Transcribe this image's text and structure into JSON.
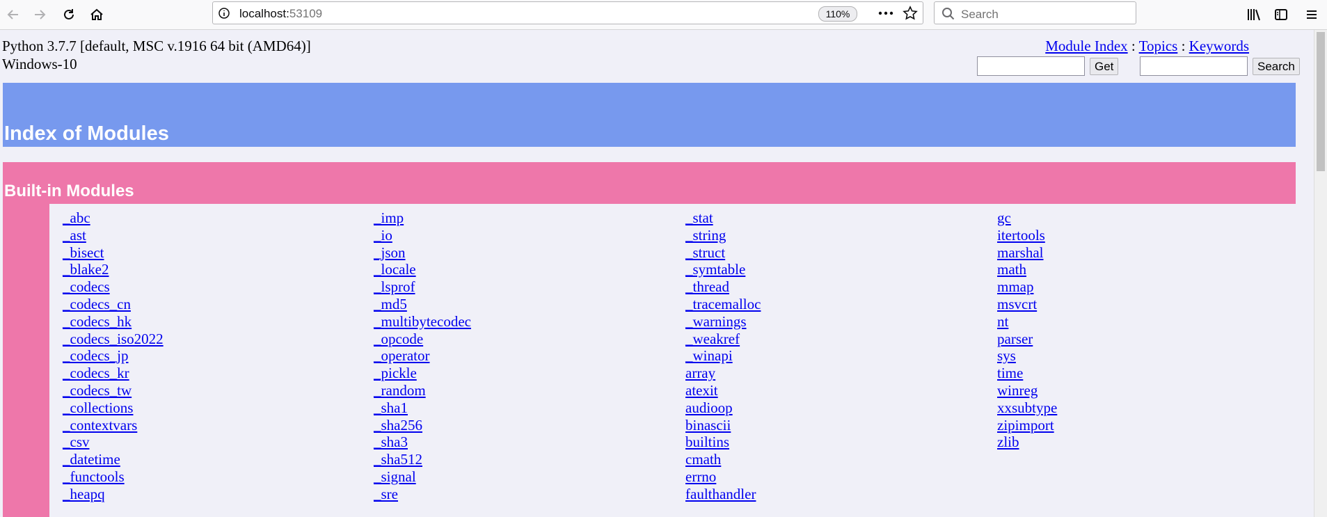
{
  "browser": {
    "url_host": "localhost:",
    "url_port": "53109",
    "zoom": "110%",
    "search_placeholder": "Search",
    "icons": [
      "back-icon",
      "forward-icon",
      "reload-icon",
      "home-icon",
      "info-icon",
      "more-icon",
      "bookmark-star-icon",
      "search-icon",
      "library-icon",
      "sidebar-icon",
      "menu-icon"
    ]
  },
  "page": {
    "python_version": "Python 3.7.7 [default, MSC v.1916 64 bit (AMD64)]",
    "platform": "Windows-10",
    "links": {
      "module_index": "Module Index",
      "sep1": " : ",
      "topics": "Topics",
      "sep2": " : ",
      "keywords": "Keywords"
    },
    "get_button": "Get",
    "search_button": "Search",
    "index_title": "Index of Modules",
    "section_title": "Built-in Modules",
    "colors": {
      "heading_band": "#7799ee",
      "section_band": "#ee77aa",
      "link": "#0000ee",
      "background": "#f0f0f8"
    },
    "columns": [
      [
        "_abc",
        "_ast",
        "_bisect",
        "_blake2",
        "_codecs",
        "_codecs_cn",
        "_codecs_hk",
        "_codecs_iso2022",
        "_codecs_jp",
        "_codecs_kr",
        "_codecs_tw",
        "_collections",
        "_contextvars",
        "_csv",
        "_datetime",
        "_functools",
        "_heapq"
      ],
      [
        "_imp",
        "_io",
        "_json",
        "_locale",
        "_lsprof",
        "_md5",
        "_multibytecodec",
        "_opcode",
        "_operator",
        "_pickle",
        "_random",
        "_sha1",
        "_sha256",
        "_sha3",
        "_sha512",
        "_signal",
        "_sre"
      ],
      [
        "_stat",
        "_string",
        "_struct",
        "_symtable",
        "_thread",
        "_tracemalloc",
        "_warnings",
        "_weakref",
        "_winapi",
        "array",
        "atexit",
        "audioop",
        "binascii",
        "builtins",
        "cmath",
        "errno",
        "faulthandler"
      ],
      [
        "gc",
        "itertools",
        "marshal",
        "math",
        "mmap",
        "msvcrt",
        "nt",
        "parser",
        "sys",
        "time",
        "winreg",
        "xxsubtype",
        "zipimport",
        "zlib"
      ]
    ]
  }
}
